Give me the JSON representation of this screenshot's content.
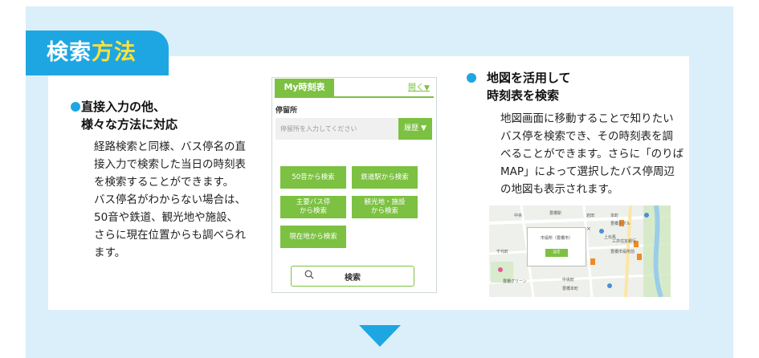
{
  "heading": {
    "part1": "検索",
    "part2": "方法"
  },
  "left_section": {
    "title": [
      "直接入力の他、",
      "様々な方法に対応"
    ],
    "body": [
      "経路検索と同様、バス停名の直",
      "接入力で検索した当日の時刻表",
      "を検索することができます。",
      "バス停名がわからない場合は、",
      "50音や鉄道、観光地や施設、",
      "さらに現在位置からも調べられ",
      "ます。"
    ]
  },
  "app": {
    "tab_label": "My時刻表",
    "open_label": "開く",
    "open_arrow": "▼",
    "stop_label": "停留所",
    "stop_placeholder": "停留所を入力してください",
    "history_label": "履歴 ▼",
    "buttons": [
      "50音から検索",
      "鉄道駅から検索",
      "主要バス停\nから検索",
      "観光地・施設\nから検索",
      "現在地から検索"
    ],
    "search_label": "検索"
  },
  "right_section": {
    "title": [
      "地図を活用して",
      "時刻表を検索"
    ],
    "body": [
      "地図画面に移動することで知りたい",
      "バス停を検索でき、その時刻表を調",
      "べることができます。さらに「のりば",
      "MAP」によって選択したバス停周辺",
      "の地図も表示されます。"
    ]
  },
  "map": {
    "popup_title": "市役所（豊橋市）",
    "popup_button": "設定",
    "labels": [
      "豊橋駅",
      "中央",
      "本町",
      "岩田",
      "豊橋グリーン",
      "中央町",
      "豊橋本町",
      "上伝馬",
      "豊橋ホテル",
      "三井住友銀行",
      "豊橋市役所前",
      "千代町"
    ]
  },
  "colors": {
    "accent_blue": "#1ea6e3",
    "accent_yellow": "#ffe23a",
    "app_green": "#7cc142",
    "background": "#dbeffb"
  }
}
